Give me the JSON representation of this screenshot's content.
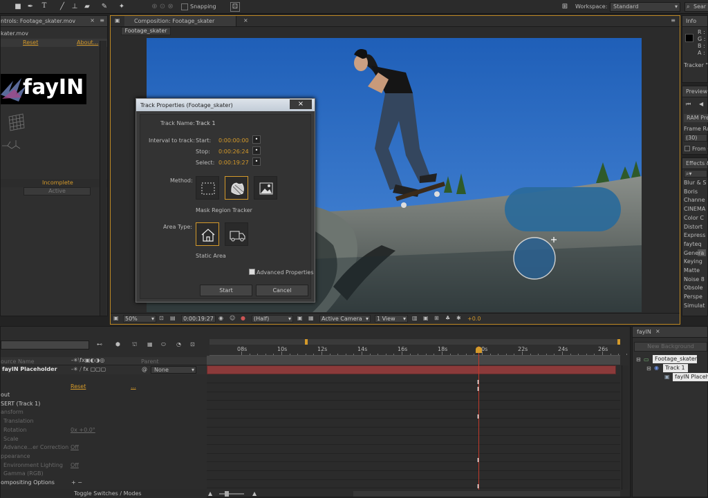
{
  "topbar": {
    "snapping": "Snapping",
    "workspace_label": "Workspace:",
    "workspace_value": "Standard",
    "search": "Sear"
  },
  "effect_controls": {
    "tab": "ntrols: Footage_skater.mov",
    "subtitle": "kater.mov",
    "reset": "Reset",
    "about": "About...",
    "logo_text": "fayIN",
    "status": "Incomplete",
    "active_btn": "Active"
  },
  "composition": {
    "tab": "Composition: Footage_skater",
    "subtab": "Footage_skater",
    "zoom": "50%",
    "timecode": "0:00:19:27",
    "resolution": "(Half)",
    "camera": "Active Camera",
    "view": "1 View",
    "exposure": "+0.0"
  },
  "dialog": {
    "title": "Track Properties (Footage_skater)",
    "track_name_label": "Track Name:",
    "track_name": "Track 1",
    "interval_label": "Interval to track:",
    "start_label": "Start:",
    "start_value": "0:00:00:00",
    "stop_label": "Stop:",
    "stop_value": "0:00:26:24",
    "select_label": "Select:",
    "select_value": "0:00:19:27",
    "method_label": "Method:",
    "method_selected": "Mask Region Tracker",
    "area_label": "Area Type:",
    "area_selected": "Static Area",
    "advanced": "Advanced Properties",
    "start_btn": "Start",
    "cancel_btn": "Cancel"
  },
  "info_panel": {
    "tab": "Info",
    "r": "R :",
    "g": "G :",
    "b": "B :",
    "a": "A :",
    "tracker": "Tracker \""
  },
  "preview_panel": {
    "tab": "Preview",
    "ram": "RAM Pre",
    "frame_rate": "Frame Ra",
    "frame_value": "(30)",
    "from": "From C"
  },
  "effects_panel": {
    "tab": "Effects &",
    "items": [
      "Blur & S",
      "Boris",
      "Channe",
      "CINEMA",
      "Color C",
      "Distort",
      "Express",
      "fayteq",
      "Genera",
      "Keying",
      "Matte",
      "Noise 8",
      "Obsole",
      "Perspe",
      "Simulat"
    ]
  },
  "timeline": {
    "ruler_labels": [
      "08s",
      "10s",
      "12s",
      "14s",
      "16s",
      "18s",
      "20s",
      "22s",
      "24s",
      "26s"
    ],
    "col_source": "ource Name",
    "col_parent": "Parent",
    "layer_name": "fayIN Placeholder",
    "parent_value": "None",
    "reset": "Reset",
    "dots": "...",
    "rows": [
      "out",
      "SERT (Track 1)",
      "ansform",
      "Translation",
      "Rotation",
      "Scale",
      "Advance...er Correction",
      "ppearance",
      "Environment Lighting",
      "Gamma (RGB)",
      "ompositing Options"
    ],
    "rotation_value": "0x +0.0°",
    "advance_value": "Off",
    "env_value": "Off",
    "toggle": "Toggle Switches / Modes"
  },
  "fayin_panel": {
    "tab": "fayIN",
    "new_bg": "New Background",
    "tree": [
      "Footage_skater",
      "Track 1",
      "fayIN Placeh"
    ]
  },
  "colors": {
    "accent": "#d59a2a",
    "layer_bar": "#8b3a3a",
    "playhead": "#c0392b",
    "sky": "#2f6fc0"
  }
}
